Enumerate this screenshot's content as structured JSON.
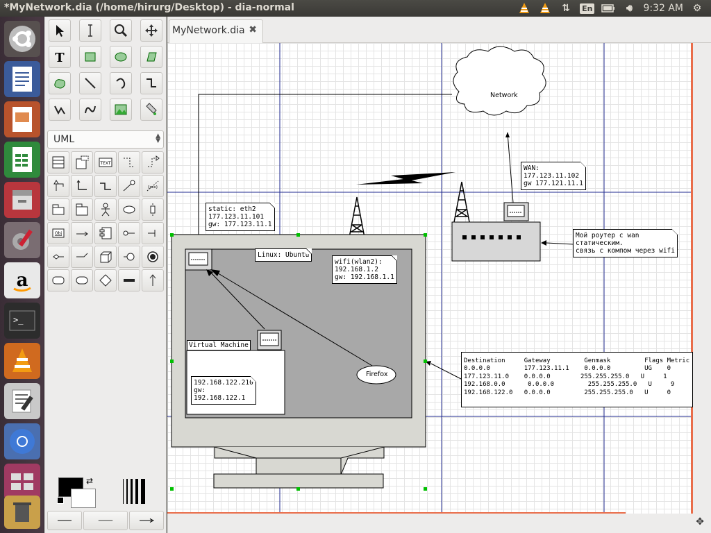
{
  "window": {
    "title": "*MyNetwork.dia (/home/hirurg/Desktop) - dia-normal"
  },
  "tray": {
    "language": "En",
    "clock": "9:32 AM"
  },
  "launcher": {
    "icons": [
      "ubuntu-dash-icon",
      "libreoffice-writer-icon",
      "libreoffice-impress-icon",
      "libreoffice-calc-icon",
      "file-manager-icon",
      "system-settings-icon",
      "amazon-icon",
      "terminal-icon",
      "vlc-icon",
      "text-editor-icon",
      "chromium-icon",
      "workspace-switcher-icon"
    ]
  },
  "toolbox": {
    "sheet_selector": "UML"
  },
  "tabs": [
    {
      "label": "MyNetwork.dia"
    }
  ],
  "diagram": {
    "cloud_label": "Network",
    "wan_note": "WAN:\n177.123.11.102\ngw 177.121.11.1",
    "static_note": "static: eth2\n177.123.11.101\ngw: 177.123.11.1",
    "linux_note": "Linux: Ubuntu",
    "wifi_note": "wifi(wlan2):\n192.168.1.2\ngw: 192.168.1.1",
    "router_note": "Мой роутер с wan\nстатическим.\nсвязь с компом через wifi",
    "vm_title": "Virtual Machine",
    "vm_note": "192.168.122.210\ngw:\n192.168.122.1",
    "firefox_label": "Firefox",
    "route_table": "Destination     Gateway         Genmask         Flags Metric\n0.0.0.0         177.123.11.1    0.0.0.0         UG    0\n177.123.11.0    0.0.0.0        255.255.255.0   U     1\n192.168.0.0      0.0.0.0         255.255.255.0   U     9\n192.168.122.0   0.0.0.0         255.255.255.0   U     0"
  },
  "colors": {
    "accent_orange": "#e96d4a",
    "guide_blue": "#1f2a8f",
    "handle_green": "#00c000"
  }
}
